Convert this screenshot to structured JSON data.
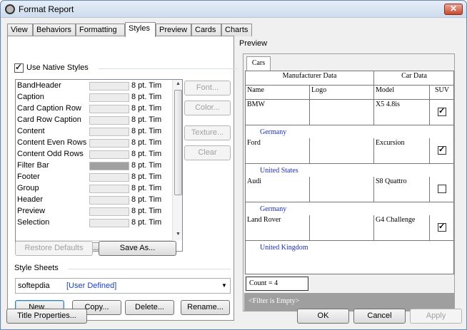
{
  "window": {
    "title": "Format Report",
    "close_glyph": "✕"
  },
  "tabs": [
    "View",
    "Behaviors",
    "Formatting",
    "Styles",
    "Preview",
    "Cards",
    "Charts"
  ],
  "styles_tab": {
    "use_native_styles_label": "Use Native Styles",
    "use_native_styles_checked": true,
    "style_list": [
      {
        "name": "BandHeader",
        "font": "8 pt. Tim"
      },
      {
        "name": "Caption",
        "font": "8 pt. Tim"
      },
      {
        "name": "Card Caption Row",
        "font": "8 pt. Tim"
      },
      {
        "name": "Card Row Caption",
        "font": "8 pt. Tim"
      },
      {
        "name": "Content",
        "font": "8 pt. Tim"
      },
      {
        "name": "Content Even Rows",
        "font": "8 pt. Tim"
      },
      {
        "name": "Content Odd Rows",
        "font": "8 pt. Tim"
      },
      {
        "name": "Filter Bar",
        "font": "8 pt. Tim",
        "swatch": "#a0a0a0"
      },
      {
        "name": "Footer",
        "font": "8 pt. Tim"
      },
      {
        "name": "Group",
        "font": "8 pt. Tim"
      },
      {
        "name": "Header",
        "font": "8 pt. Tim"
      },
      {
        "name": "Preview",
        "font": "8 pt. Tim"
      },
      {
        "name": "Selection",
        "font": "8 pt. Tim"
      }
    ],
    "side_buttons": [
      "Font...",
      "Color...",
      "Texture...",
      "Clear"
    ],
    "restore_defaults": "Restore Defaults",
    "save_as": "Save As...",
    "style_sheets_label": "Style Sheets",
    "style_sheet_name": "softepdia",
    "style_sheet_type": "[User Defined]",
    "sheet_buttons": [
      "New...",
      "Copy...",
      "Delete...",
      "Rename..."
    ]
  },
  "preview": {
    "label": "Preview",
    "card_tab": "Cars",
    "band_headers": [
      "Manufacturer Data",
      "Car Data"
    ],
    "columns": [
      "Name",
      "Logo",
      "Model",
      "SUV"
    ],
    "rows": [
      {
        "name": "BMW",
        "model": "X5 4.8is",
        "suv": true,
        "country": "Germany"
      },
      {
        "name": "Ford",
        "model": "Excursion",
        "suv": true,
        "country": "United States"
      },
      {
        "name": "Audi",
        "model": "S8 Quattro",
        "suv": false,
        "country": "Germany"
      },
      {
        "name": "Land Rover",
        "model": "G4 Challenge",
        "suv": true,
        "country": "United Kingdom"
      }
    ],
    "count": "Count = 4",
    "filter_text": "<Filter is Empty>"
  },
  "footer": {
    "title_properties": "Title Properties...",
    "ok": "OK",
    "cancel": "Cancel",
    "apply": "Apply"
  }
}
